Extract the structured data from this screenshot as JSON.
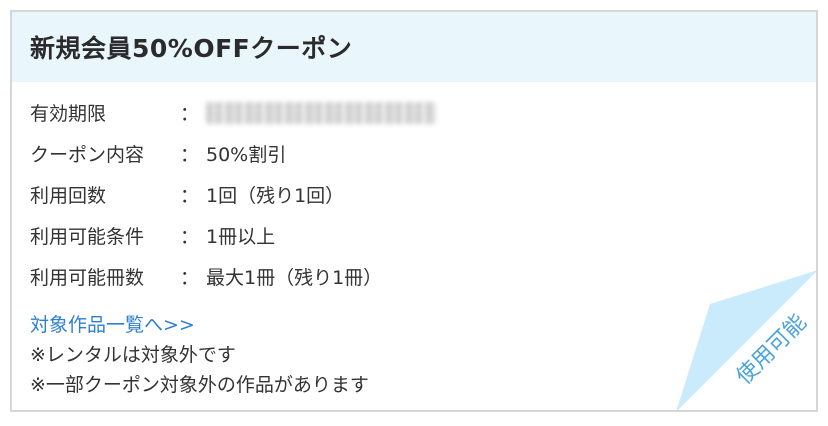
{
  "coupon": {
    "title": "新規会員50%OFFクーポン",
    "details": [
      {
        "label": "有効期限",
        "colon": "：",
        "value": ""
      },
      {
        "label": "クーポン内容",
        "colon": "：",
        "value": "50%割引"
      },
      {
        "label": "利用回数",
        "colon": "：",
        "value": "1回（残り1回）"
      },
      {
        "label": "利用可能条件",
        "colon": "：",
        "value": "1冊以上"
      },
      {
        "label": "利用可能冊数",
        "colon": "：",
        "value": "最大1冊（残り1冊）"
      }
    ],
    "link_label": "対象作品一覧へ>>",
    "notes": [
      "※レンタルは対象外です",
      "※一部クーポン対象外の作品があります"
    ],
    "status_label": "使用可能"
  },
  "colors": {
    "header_bg": "#e9f6fc",
    "link": "#2f7fd0",
    "corner_fill": "#c9ebfb",
    "corner_text": "#4aa3da",
    "border": "#d6d6d6"
  }
}
